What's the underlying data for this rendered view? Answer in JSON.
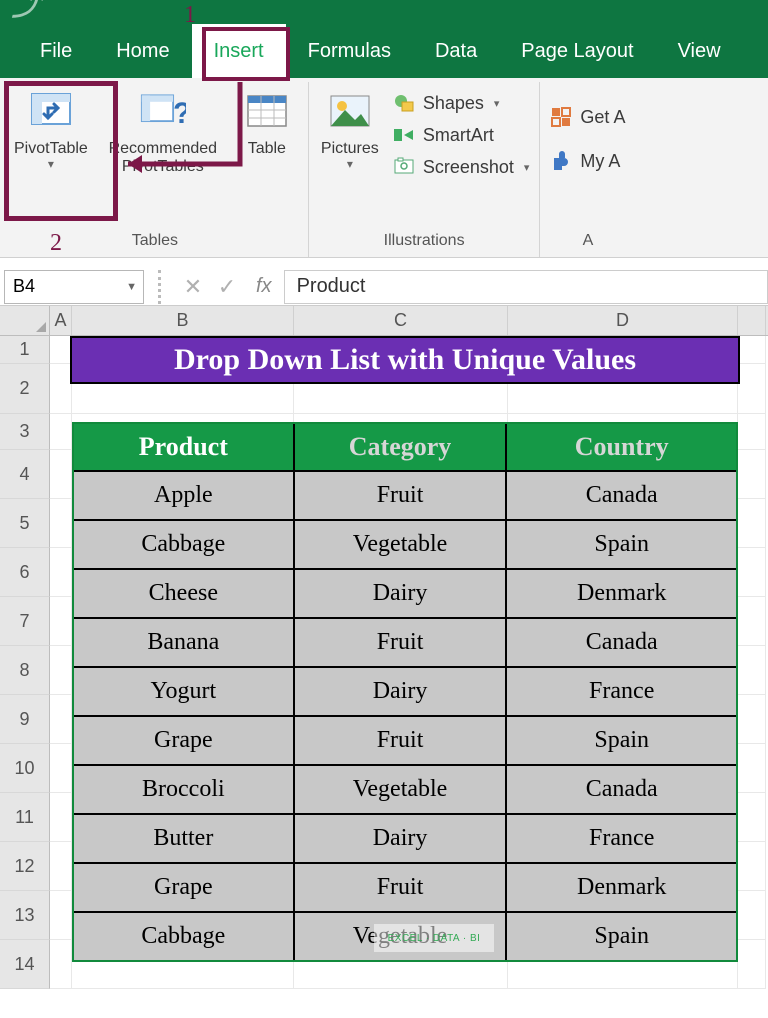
{
  "tabs": {
    "file": "File",
    "home": "Home",
    "insert": "Insert",
    "formulas": "Formulas",
    "data": "Data",
    "pagelayout": "Page Layout",
    "view": "View"
  },
  "active_tab": "insert",
  "ribbon": {
    "tables_group": "Tables",
    "pivottable": "PivotTable",
    "recommended": "Recommended\nPivotTables",
    "table": "Table",
    "illustrations_group": "Illustrations",
    "pictures": "Pictures",
    "shapes": "Shapes",
    "smartart": "SmartArt",
    "screenshot": "Screenshot",
    "addins_partial": "A",
    "getaddins": "Get A",
    "myaddins": "My A"
  },
  "annotations": {
    "one": "1",
    "two": "2"
  },
  "namebox": "B4",
  "fx_label": "fx",
  "formula_value": "Product",
  "columns": [
    "A",
    "B",
    "C",
    "D"
  ],
  "row_headers": [
    "1",
    "2",
    "3",
    "4",
    "5",
    "6",
    "7",
    "8",
    "9",
    "10",
    "11",
    "12",
    "13",
    "14"
  ],
  "banner": "Drop Down List with Unique Values",
  "table_headers": {
    "product": "Product",
    "category": "Category",
    "country": "Country"
  },
  "table_rows": [
    {
      "product": "Apple",
      "category": "Fruit",
      "country": "Canada"
    },
    {
      "product": "Cabbage",
      "category": "Vegetable",
      "country": "Spain"
    },
    {
      "product": "Cheese",
      "category": "Dairy",
      "country": "Denmark"
    },
    {
      "product": "Banana",
      "category": "Fruit",
      "country": "Canada"
    },
    {
      "product": "Yogurt",
      "category": "Dairy",
      "country": "France"
    },
    {
      "product": "Grape",
      "category": "Fruit",
      "country": "Spain"
    },
    {
      "product": "Broccoli",
      "category": "Vegetable",
      "country": "Canada"
    },
    {
      "product": "Butter",
      "category": "Dairy",
      "country": "France"
    },
    {
      "product": "Grape",
      "category": "Fruit",
      "country": "Denmark"
    },
    {
      "product": "Cabbage",
      "category": "Vegetable",
      "country": "Spain"
    }
  ],
  "watermark": "EXCEL · DATA · BI"
}
